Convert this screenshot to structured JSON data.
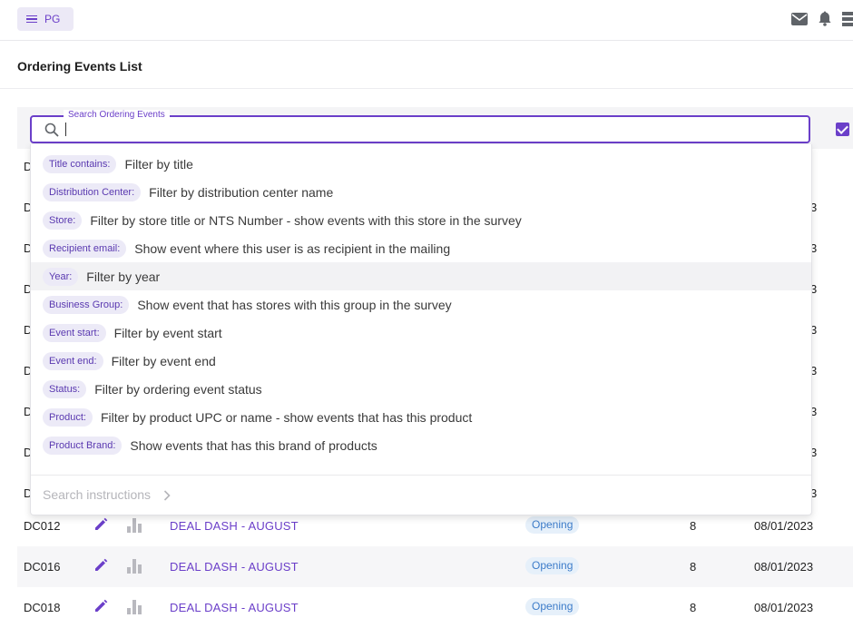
{
  "topbar": {
    "menu_label": "PG",
    "icons": [
      "menu-icon",
      "mail-icon",
      "bell-icon",
      "grid-menu-icon"
    ]
  },
  "page": {
    "title": "Ordering Events List"
  },
  "search": {
    "label": "Search Ordering Events",
    "value": "",
    "icon": "search-icon"
  },
  "suggestions": [
    {
      "chip": "Title contains:",
      "desc": "Filter by title"
    },
    {
      "chip": "Distribution Center:",
      "desc": "Filter by distribution center name"
    },
    {
      "chip": "Store:",
      "desc": "Filter by store title or NTS Number - show events with this store in the survey"
    },
    {
      "chip": "Recipient email:",
      "desc": "Show event where this user is as recipient in the mailing"
    },
    {
      "chip": "Year:",
      "desc": "Filter by year"
    },
    {
      "chip": "Business Group:",
      "desc": "Show event that has stores with this group in the survey"
    },
    {
      "chip": "Event start:",
      "desc": "Filter by event start"
    },
    {
      "chip": "Event end:",
      "desc": "Filter by event end"
    },
    {
      "chip": "Status:",
      "desc": "Filter by ordering event status"
    },
    {
      "chip": "Product:",
      "desc": "Filter by product UPC or name - show events that has this product"
    },
    {
      "chip": "Product Brand:",
      "desc": "Show events that has this brand of products"
    }
  ],
  "instructions": {
    "label": "Search instructions"
  },
  "peek": {
    "left": [
      "D",
      "D",
      "D",
      "D",
      "D",
      "D",
      "D",
      "D",
      "D"
    ],
    "right": [
      "3",
      "3",
      "3",
      "3",
      "3",
      "3",
      "3",
      "3"
    ]
  },
  "rows": [
    {
      "code": "DC012",
      "name": "DEAL DASH - AUGUST",
      "status": "Opening",
      "count": "8",
      "date": "08/01/2023"
    },
    {
      "code": "DC016",
      "name": "DEAL DASH - AUGUST",
      "status": "Opening",
      "count": "8",
      "date": "08/01/2023"
    },
    {
      "code": "DC018",
      "name": "DEAL DASH - AUGUST",
      "status": "Opening",
      "count": "8",
      "date": "08/01/2023"
    }
  ],
  "colors": {
    "accent": "#6b3fc9",
    "status_bg": "#e6f0fa",
    "status_text": "#3d7cc9"
  }
}
